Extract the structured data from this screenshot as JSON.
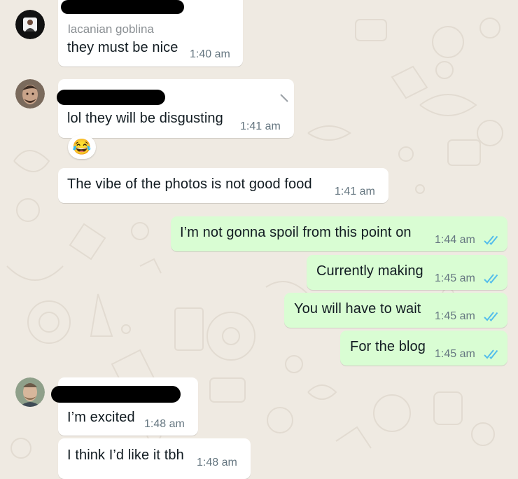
{
  "colors": {
    "wallpaper": "#efeae2",
    "incoming_bubble": "#ffffff",
    "outgoing_bubble": "#d9fdd3",
    "timestamp": "#667781",
    "read_ticks": "#53bdeb",
    "sender_name": "#8a8f93"
  },
  "messages": [
    {
      "direction": "incoming",
      "sender": "lacanian goblina",
      "text": "they must be nice",
      "time": "1:40 am"
    },
    {
      "direction": "incoming",
      "text": "lol they will be disgusting",
      "time": "1:41 am",
      "reaction": "😂"
    },
    {
      "direction": "incoming",
      "text": "The vibe of the photos is not good food",
      "time": "1:41 am"
    },
    {
      "direction": "outgoing",
      "text": "I’m not gonna spoil from this point on",
      "time": "1:44 am",
      "status": "read"
    },
    {
      "direction": "outgoing",
      "text": "Currently making",
      "time": "1:45 am",
      "status": "read"
    },
    {
      "direction": "outgoing",
      "text": "You will have to wait",
      "time": "1:45 am",
      "status": "read"
    },
    {
      "direction": "outgoing",
      "text": "For the blog",
      "time": "1:45 am",
      "status": "read"
    },
    {
      "direction": "incoming",
      "text": "I’m excited",
      "time": "1:48 am"
    },
    {
      "direction": "incoming",
      "text": "I think I’d like it tbh",
      "time": "1:48 am"
    }
  ]
}
